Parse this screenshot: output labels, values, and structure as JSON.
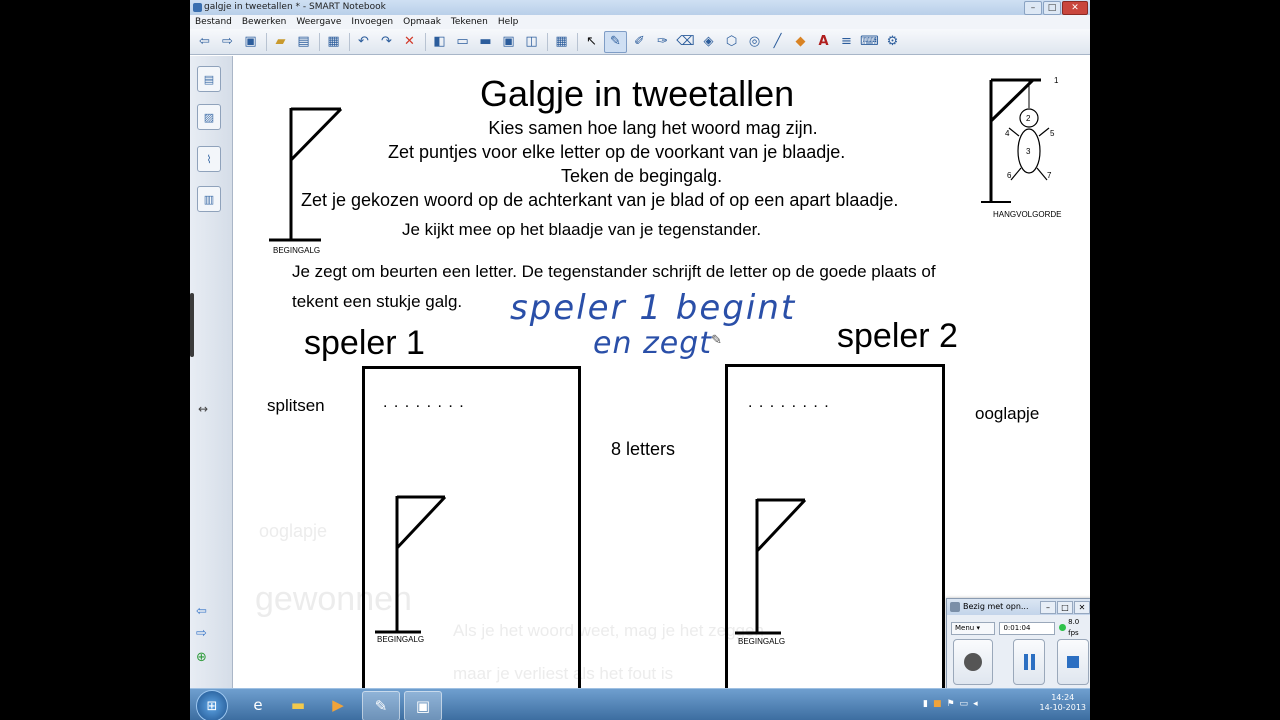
{
  "window": {
    "title": "galgje in tweetallen * - SMART Notebook",
    "controls": [
      "–",
      "□",
      "✕"
    ]
  },
  "menu": {
    "items": [
      "Bestand",
      "Bewerken",
      "Weergave",
      "Invoegen",
      "Opmaak",
      "Tekenen",
      "Help"
    ]
  },
  "toolbar": {
    "icons": [
      "back-arrow-icon",
      "forward-arrow-icon",
      "add-page-icon",
      "separator",
      "open-folder-icon",
      "save-icon",
      "separator",
      "paste-icon",
      "separator",
      "undo-icon",
      "redo-icon",
      "delete-icon",
      "separator",
      "screen-shade-icon",
      "full-screen-icon",
      "display-icon",
      "capture-icon",
      "document-camera-icon",
      "separator",
      "table-icon",
      "separator",
      "select-icon",
      "pen-icon",
      "creative-pen-icon",
      "magic-pen-icon",
      "eraser-icon",
      "shape-icon",
      "regular-polygon-icon",
      "connector-icon",
      "line-icon",
      "fill-icon",
      "text-icon",
      "properties-icon",
      "keyboard-icon",
      "toolbar-settings-icon"
    ]
  },
  "page": {
    "title": "Galgje in tweetallen",
    "lines": [
      "Kies samen hoe lang het woord mag zijn.",
      "Zet puntjes voor elke letter op de voorkant van je blaadje.",
      "Teken de begingalg.",
      "Zet je gekozen woord op de achterkant van je blad of op een apart blaadje.",
      "Je kijkt mee op het blaadje van je tegenstander."
    ],
    "paragraph_line1": "Je zegt om beurten een letter. De tegenstander schrijft de letter op de goede plaats of",
    "paragraph_line2": "tekent een stukje galg.",
    "begingalg_label": "BEGINGALG",
    "hangvolgorde_label": "HANGVOLGORDE",
    "hang_numbers": [
      "1",
      "2",
      "3",
      "4",
      "5",
      "6",
      "7"
    ],
    "handwriting_line1": "speler 1 begint",
    "handwriting_line2": "en zegt",
    "player1_label": "speler 1",
    "player2_label": "speler 2",
    "player1_word_dots": ". . . . . . . .",
    "player2_word_dots": ". . . . . . . .",
    "word_length_label": "8 letters",
    "player1_word": "splitsen",
    "player2_word": "ooglapje",
    "card1_galg_label": "BEGINGALG",
    "card2_galg_label": "BEGINGALG",
    "faded_text_1": "ooglapje",
    "faded_text_2": "gewonnen",
    "faded_text_3": "Als je het woord weet, mag je het zeggen",
    "faded_text_4": "maar je verliest als het fout is"
  },
  "taskbar": {
    "time": "14:24",
    "date": "14-10-2013"
  },
  "recorder": {
    "title": "Bezig met opn...",
    "menu_label": "Menu",
    "elapsed": "0:01:04",
    "fps": "8.0 fps"
  },
  "colors": {
    "ink": "#000000",
    "handwriting": "#2a4fa8",
    "faded": "#ececec",
    "taskbar": "#4a7db3"
  }
}
